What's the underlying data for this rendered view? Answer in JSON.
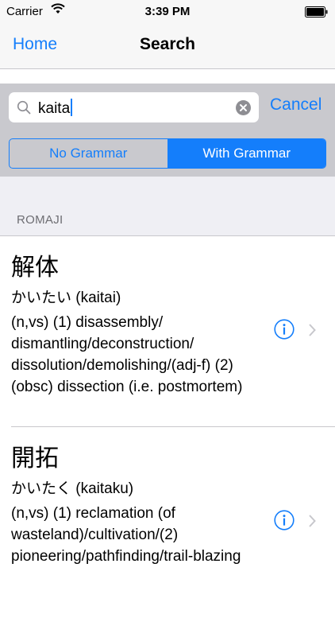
{
  "status_bar": {
    "carrier": "Carrier",
    "time": "3:39 PM"
  },
  "nav": {
    "back_label": "Home",
    "title": "Search"
  },
  "search": {
    "query": "kaita",
    "cancel_label": "Cancel"
  },
  "segments": [
    {
      "label": "No Grammar",
      "selected": false
    },
    {
      "label": "With Grammar",
      "selected": true
    }
  ],
  "section_header": "ROMAJI",
  "results": [
    {
      "kanji": "解体",
      "reading": "かいたい (kaitai)",
      "definition": "(n,vs) (1) disassembly/ dismantling/deconstruction/ dissolution/demolishing/(adj-f) (2) (obsc) dissection (i.e. postmortem)"
    },
    {
      "kanji": "開拓",
      "reading": "かいたく (kaitaku)",
      "definition": "(n,vs) (1) reclamation (of wasteland)/cultivation/(2) pioneering/pathfinding/trail-blazing"
    }
  ],
  "colors": {
    "accent": "#147efb",
    "search_bar_bg": "#c9c9ce",
    "group_bg": "#efeff4"
  },
  "icons": [
    "wifi-icon",
    "battery-icon",
    "search-icon",
    "clear-icon",
    "info-icon",
    "chevron-right-icon"
  ]
}
